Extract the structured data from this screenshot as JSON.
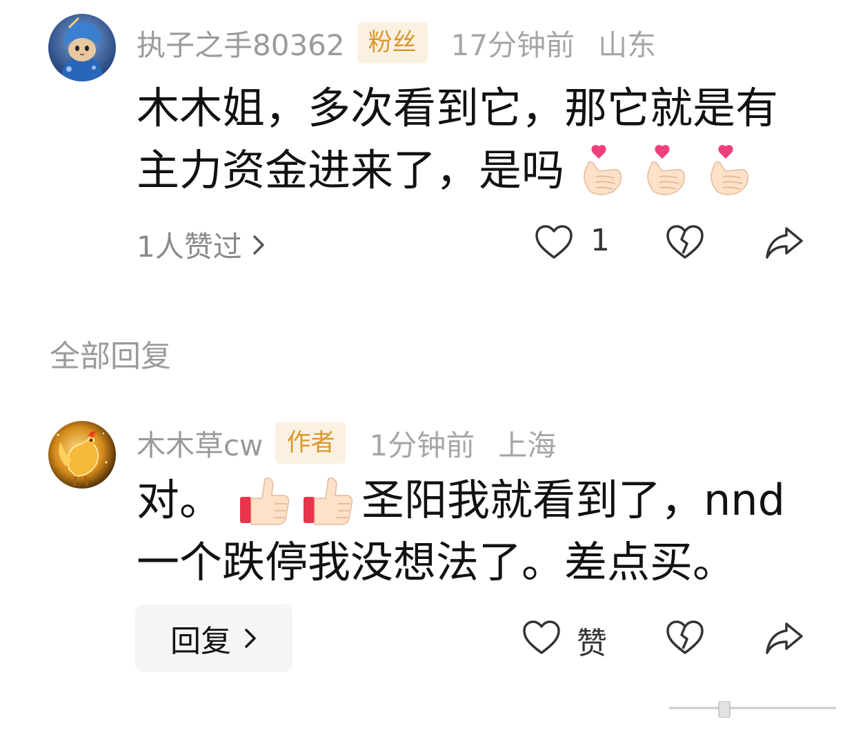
{
  "comment": {
    "username": "执子之手80362",
    "badge": "粉丝",
    "time": "17分钟前",
    "location": "山东",
    "text_line1": "木木姐，多次看到它，那它就是有",
    "text_line2": "主力资金进来了，是吗",
    "emojis": [
      "finger-heart-emoji",
      "finger-heart-emoji",
      "finger-heart-emoji"
    ],
    "liked_by": "1人赞过",
    "like_count": "1",
    "avatar_icon": "blue-hooded-cat-avatar"
  },
  "replies_section": {
    "title": "全部回复"
  },
  "reply": {
    "username": "木木草cw",
    "badge": "作者",
    "time": "1分钟前",
    "location": "上海",
    "text_line1_prefix": "对。",
    "text_line1_suffix": "圣阳我就看到了，nnd",
    "text_line2": "一个跌停我没想法了。差点买。",
    "emojis": [
      "thumbs-up-emoji",
      "thumbs-up-emoji"
    ],
    "reply_button": "回复",
    "like_label": "赞",
    "avatar_icon": "golden-rooster-avatar"
  },
  "colors": {
    "badge_bg": "#fbf1e1",
    "badge_text": "#d9982f",
    "muted_text": "#9a9a9a",
    "body_text": "#111111"
  }
}
